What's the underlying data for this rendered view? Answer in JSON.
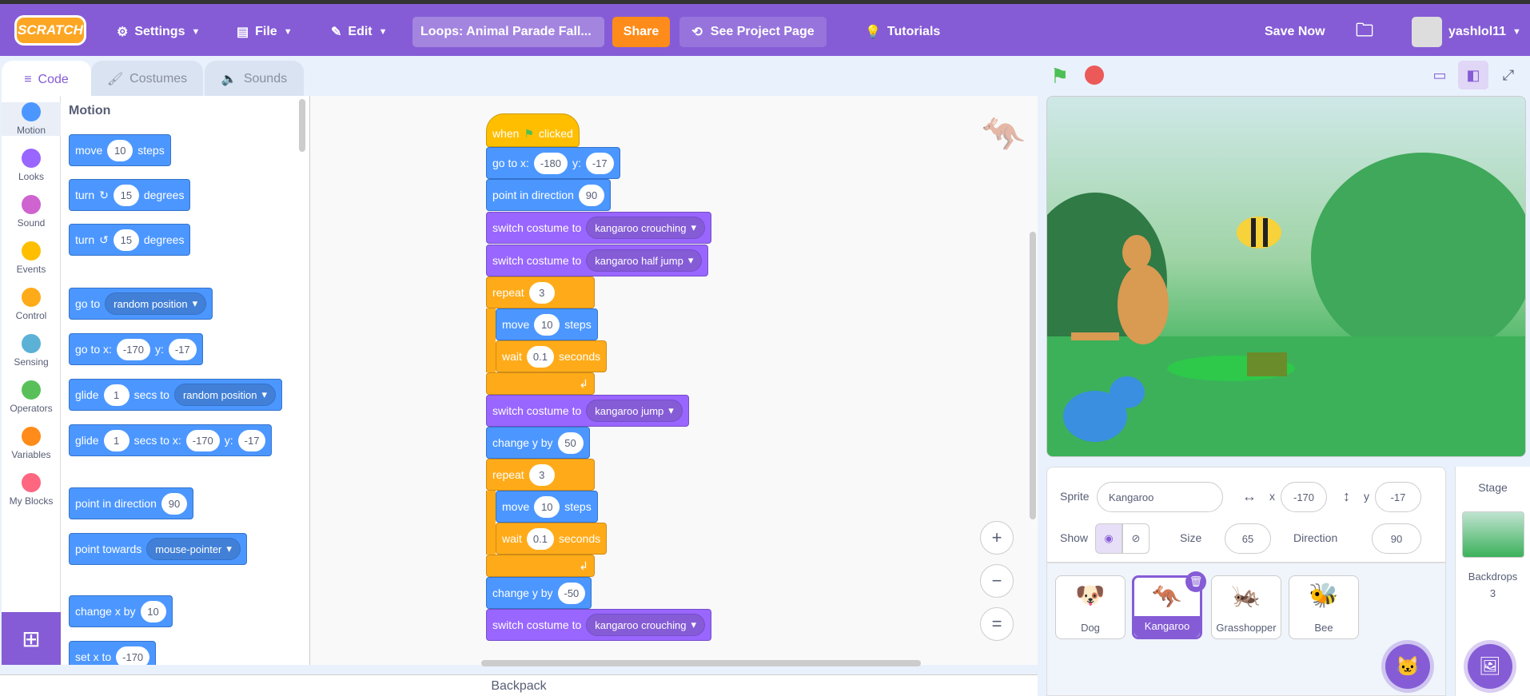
{
  "menubar": {
    "logo": "SCRATCH",
    "settings": "Settings",
    "file": "File",
    "edit": "Edit",
    "project_title": "Loops: Animal Parade Fall...",
    "share": "Share",
    "see_project_page": "See Project Page",
    "tutorials": "Tutorials",
    "save_now": "Save Now",
    "username": "yashlol11"
  },
  "tabs": {
    "code": "Code",
    "costumes": "Costumes",
    "sounds": "Sounds"
  },
  "categories": [
    "Motion",
    "Looks",
    "Sound",
    "Events",
    "Control",
    "Sensing",
    "Operators",
    "Variables",
    "My Blocks"
  ],
  "category_colors": [
    "#4c97ff",
    "#9966ff",
    "#cf63cf",
    "#ffbf00",
    "#ffab19",
    "#5cb1d6",
    "#59c059",
    "#ff8c1a",
    "#ff6680"
  ],
  "palette": {
    "heading": "Motion",
    "move": {
      "a": "move",
      "n": "10",
      "b": "steps"
    },
    "turn_cw": {
      "a": "turn",
      "n": "15",
      "b": "degrees"
    },
    "turn_ccw": {
      "a": "turn",
      "n": "15",
      "b": "degrees"
    },
    "goto": {
      "a": "go to",
      "dd": "random position"
    },
    "gotoxy": {
      "a": "go to x:",
      "x": "-170",
      "y_label": "y:",
      "y": "-17"
    },
    "glide": {
      "a": "glide",
      "n": "1",
      "b": "secs to",
      "dd": "random position"
    },
    "glidexy": {
      "a": "glide",
      "n": "1",
      "b": "secs to x:",
      "x": "-170",
      "y_label": "y:",
      "y": "-17"
    },
    "point_dir": {
      "a": "point in direction",
      "n": "90"
    },
    "point_towards": {
      "a": "point towards",
      "dd": "mouse-pointer"
    },
    "change_x": {
      "a": "change x by",
      "n": "10"
    },
    "set_x": {
      "a": "set x to",
      "n": "-170"
    }
  },
  "script": {
    "hat_a": "when",
    "hat_b": "clicked",
    "gotoxy": {
      "a": "go to x:",
      "x": "-180",
      "y_label": "y:",
      "y": "-17"
    },
    "point_dir": {
      "a": "point in direction",
      "n": "90"
    },
    "costume1": {
      "a": "switch costume to",
      "dd": "kangaroo crouching"
    },
    "costume2": {
      "a": "switch costume to",
      "dd": "kangaroo half jump"
    },
    "repeat1": {
      "a": "repeat",
      "n": "3"
    },
    "move1": {
      "a": "move",
      "n": "10",
      "b": "steps"
    },
    "wait1": {
      "a": "wait",
      "n": "0.1",
      "b": "seconds"
    },
    "costume3": {
      "a": "switch costume to",
      "dd": "kangaroo jump"
    },
    "changey1": {
      "a": "change y by",
      "n": "50"
    },
    "repeat2": {
      "a": "repeat",
      "n": "3"
    },
    "move2": {
      "a": "move",
      "n": "10",
      "b": "steps"
    },
    "wait2": {
      "a": "wait",
      "n": "0.1",
      "b": "seconds"
    },
    "changey2": {
      "a": "change y by",
      "n": "-50"
    },
    "costume4": {
      "a": "switch costume to",
      "dd": "kangaroo crouching"
    }
  },
  "backpack": "Backpack",
  "zoom": {
    "in": "+",
    "out": "−",
    "reset": "="
  },
  "sprite_info": {
    "sprite_label": "Sprite",
    "sprite_name": "Kangaroo",
    "x_label": "x",
    "x": "-170",
    "y_label": "y",
    "y": "-17",
    "show_label": "Show",
    "size_label": "Size",
    "size": "65",
    "direction_label": "Direction",
    "direction": "90"
  },
  "sprites": [
    "Dog",
    "Kangaroo",
    "Grasshopper",
    "Bee"
  ],
  "stage_panel": {
    "title": "Stage",
    "backdrops_label": "Backdrops",
    "backdrops_count": "3"
  },
  "colors": {
    "accent": "#855cd6",
    "motion": "#4c97ff",
    "looks": "#9966ff",
    "control": "#ffab19",
    "events": "#ffbf00",
    "share": "#ff8c1a"
  }
}
